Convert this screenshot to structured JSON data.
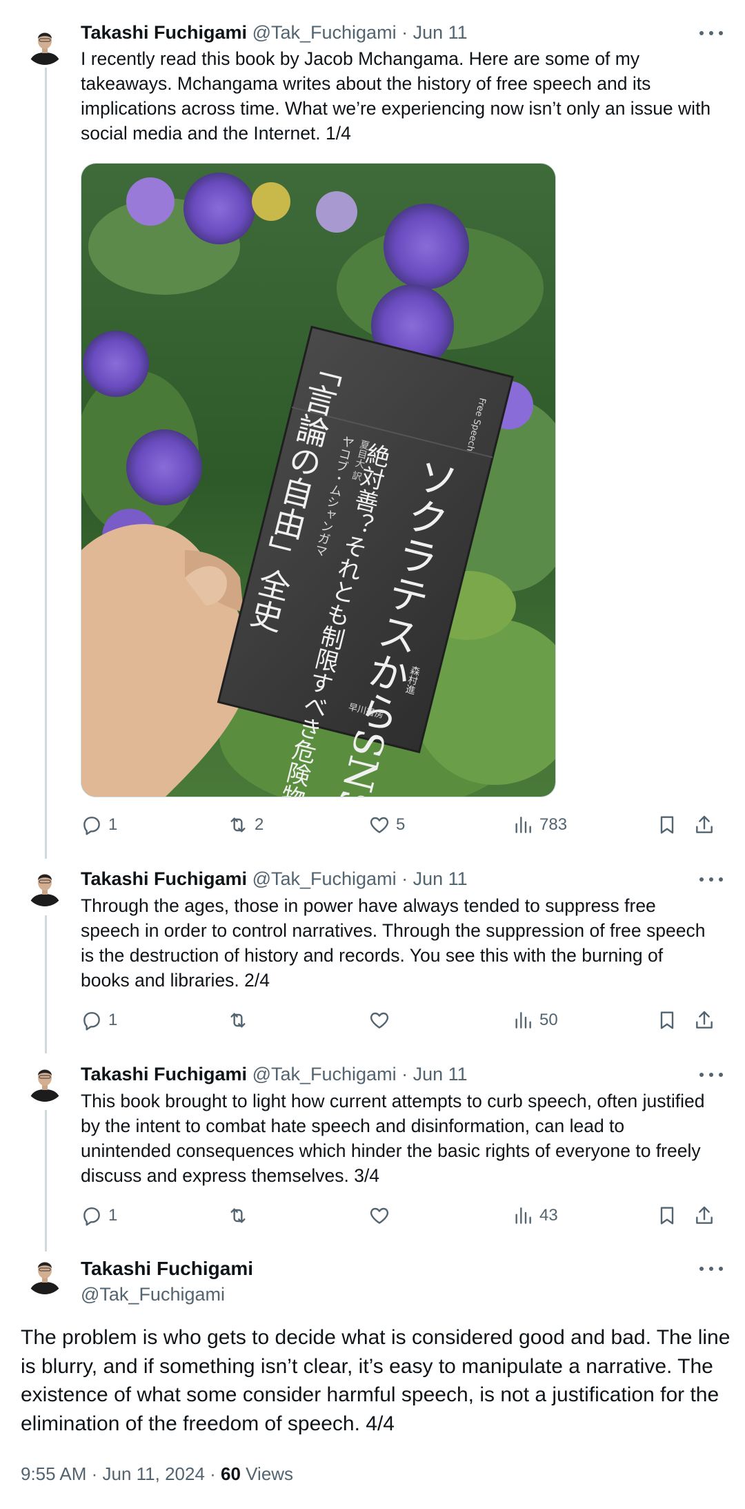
{
  "tweets": [
    {
      "name": "Takashi Fuchigami",
      "handle": "@Tak_Fuchigami",
      "separator": "·",
      "date": "Jun 11",
      "text": "I recently read this book by Jacob Mchangama. Here are some of my takeaways. Mchangama writes about the history of free speech and its implications across time. What we’re experiencing now isn’t only an issue with social media and the Internet. 1/4",
      "replies": "1",
      "reposts": "2",
      "likes": "5",
      "views": "783"
    },
    {
      "name": "Takashi Fuchigami",
      "handle": "@Tak_Fuchigami",
      "separator": "·",
      "date": "Jun 11",
      "text": "Through the ages, those in power have always tended to suppress free speech in order to control narratives. Through the suppression of free speech is the destruction of history and records. You see this with the burning of books and libraries. 2/4",
      "replies": "1",
      "reposts": "",
      "likes": "",
      "views": "50"
    },
    {
      "name": "Takashi Fuchigami",
      "handle": "@Tak_Fuchigami",
      "separator": "·",
      "date": "Jun 11",
      "text": "This book brought to light how current attempts to curb speech, often justified by the intent to combat hate speech and disinformation, can lead to unintended consequences which hinder the basic rights of everyone to freely discuss and express themselves. 3/4",
      "replies": "1",
      "reposts": "",
      "likes": "",
      "views": "43"
    }
  ],
  "focal": {
    "name": "Takashi Fuchigami",
    "handle": "@Tak_Fuchigami",
    "text": "The problem is who gets to decide what is considered good and bad. The line is blurry, and if something isn’t clear, it’s easy to manipulate a narrative. The existence of what some consider harmful speech, is not a justification for the elimination of the freedom of speech. 4/4",
    "time": "9:55 AM · Jun 11, 2024 · ",
    "views_count": "60",
    "views_label": " Views"
  },
  "book": {
    "title": "ソクラテスからSNS",
    "subtitle": "絶対善？それとも制限すべき危険物？",
    "series_title": "「言論の自由」全史",
    "author": "ヤコブ・ムシャンガマ",
    "english_title": "Free Speech",
    "publisher": "早川書房",
    "translator": "夏目大 訳",
    "commentary": "森村進"
  },
  "icons": [
    "reply-icon",
    "repost-icon",
    "like-icon",
    "views-icon",
    "bookmark-icon",
    "share-icon",
    "more-icon"
  ],
  "colors": {
    "text": "#0f1419",
    "secondary": "#536471",
    "border": "#cfd9de"
  }
}
